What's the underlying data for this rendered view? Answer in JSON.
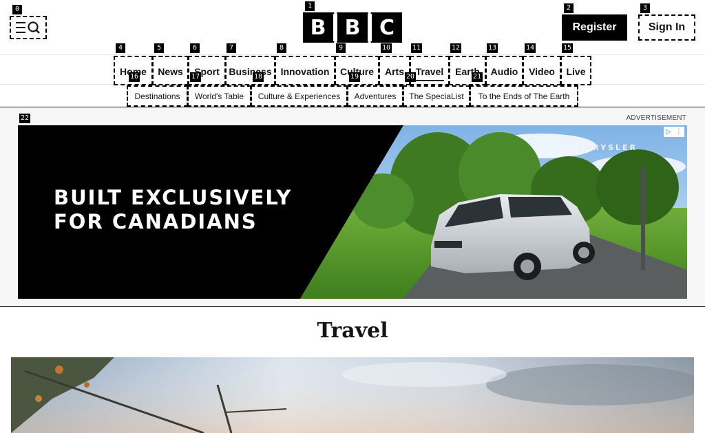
{
  "header": {
    "menu_icon": "menu-search-icon",
    "logo_letters": [
      "B",
      "B",
      "C"
    ],
    "register_label": "Register",
    "signin_label": "Sign In"
  },
  "nav": {
    "items": [
      "Home",
      "News",
      "Sport",
      "Business",
      "Innovation",
      "Culture",
      "Arts",
      "Travel",
      "Earth",
      "Audio",
      "Video",
      "Live"
    ],
    "active": "Travel"
  },
  "subnav": {
    "items": [
      "Destinations",
      "World's Table",
      "Culture & Experiences",
      "Adventures",
      "The SpeciaList",
      "To the Ends of The Earth"
    ]
  },
  "ad": {
    "label": "ADVERTISEMENT",
    "headline_line1": "BUILT EXCLUSIVELY",
    "headline_line2": "FOR CANADIANS",
    "brand": "CHRYSLER"
  },
  "markers": [
    "0",
    "1",
    "2",
    "3",
    "4",
    "5",
    "6",
    "7",
    "8",
    "9",
    "10",
    "11",
    "12",
    "13",
    "14",
    "15",
    "16",
    "17",
    "18",
    "19",
    "20",
    "21",
    "22"
  ],
  "page": {
    "title": "Travel"
  }
}
